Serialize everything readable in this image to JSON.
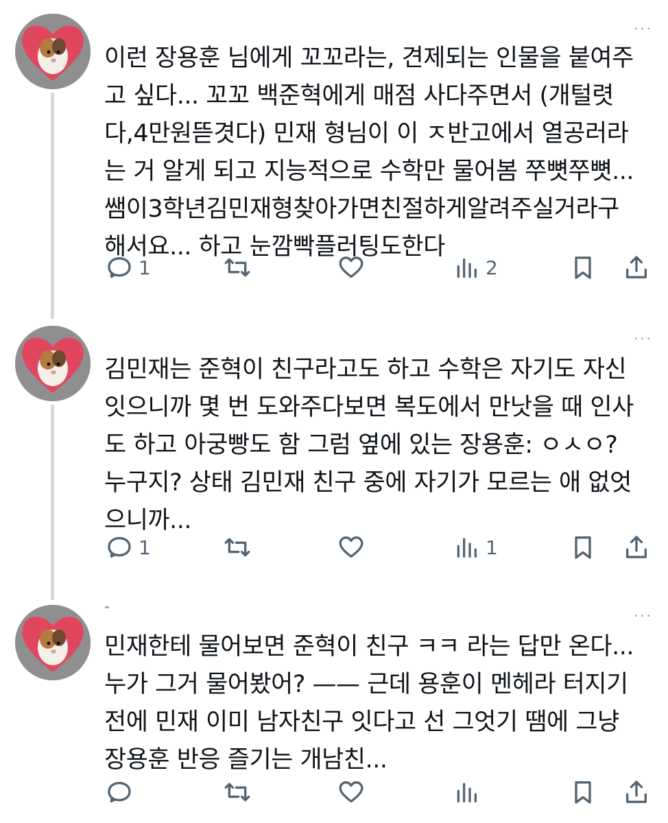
{
  "tweets": [
    {
      "text": "이런 장용훈 님에게 꼬꼬라는, 견제되는 인물을 붙여주\n고 싶다... 꼬꼬 백준혁에게 매점 사다주면서 (개털렷\n다,4만원뜯겻다) 민재 형님이 이 ㅈ반고에서 열공러라\n는 거 알게 되고 지능적으로 수학만 물어봄 쭈뼛쭈뼛...\n쌤이3학년김민재형찾아가면친절하게알려주실거라구\n해서요... 하고 눈깜빡플러팅도한다",
      "replies": "1",
      "retweets": "",
      "likes": "",
      "views": "2"
    },
    {
      "text": "김민재는 준혁이 친구라고도 하고 수학은 자기도 자신\n잇으니까 몇 번 도와주다보면 복도에서 만낫을 때 인사\n도 하고 아궁빵도 함 그럼 옆에 있는 장용훈: ㅇㅅㅇ?\n누구지? 상태 김민재 친구 중에 자기가 모르는 애 없엇\n으니까...",
      "replies": "1",
      "retweets": "",
      "likes": "",
      "views": "1"
    },
    {
      "text": "민재한테 물어보면 준혁이 친구 ㅋㅋ 라는 답만 온다...\n누가 그거 물어봤어? —— 근데 용훈이 멘헤라 터지기\n전에 민재 이미 남자친구 잇다고 선 그엇기 땜에 그냥\n장용훈 반응 즐기는 개남친...",
      "replies": "",
      "retweets": "",
      "likes": "",
      "views": ""
    }
  ],
  "icons": {
    "reply": "reply-icon",
    "retweet": "retweet-icon",
    "like": "heart-icon",
    "views": "views-icon",
    "bookmark": "bookmark-icon",
    "share": "share-icon",
    "more": "more-icon",
    "avatar": "guinea-pig-avatar"
  },
  "colors": {
    "text": "#0f1419",
    "icon": "#536471",
    "thread_line": "#cfd9de",
    "avatar_heart": "#e0475f"
  }
}
